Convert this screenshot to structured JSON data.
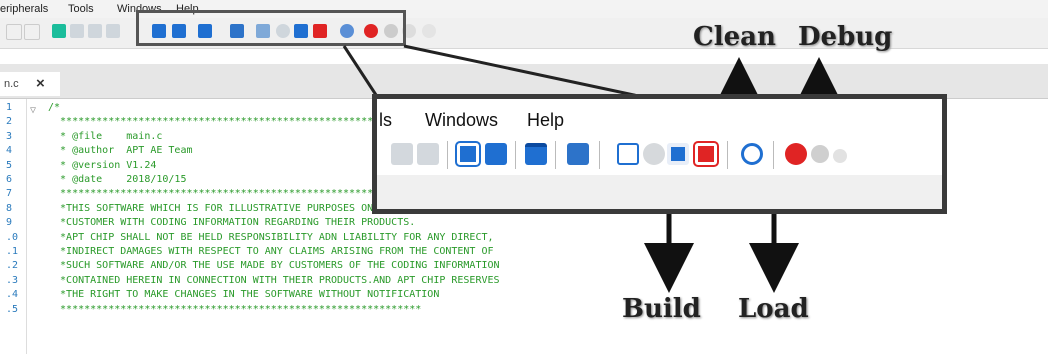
{
  "menubar": {
    "items": [
      "eripherals",
      "Tools",
      "Windows",
      "Help"
    ]
  },
  "tab": {
    "label": "n.c",
    "close": "×"
  },
  "editor": {
    "line_numbers": [
      "1",
      "2",
      "3",
      "4",
      "5",
      "6",
      "7",
      "8",
      "9",
      ".0",
      ".1",
      ".2",
      ".3",
      ".4",
      ".5"
    ],
    "lines": [
      "/*",
      "  ************************************************************",
      "  * @file    main.c",
      "  * @author  APT AE Team",
      "  * @version V1.24",
      "  * @date    2018/10/15",
      "  ************************************************************",
      "  *THIS SOFTWARE WHICH IS FOR ILLUSTRATIVE PURPOSES ONLY WHICH PROVIDES",
      "  *CUSTOMER WITH CODING INFORMATION REGARDING THEIR PRODUCTS.",
      "  *APT CHIP SHALL NOT BE HELD RESPONSIBILITY ADN LIABILITY FOR ANY DIRECT,",
      "  *INDIRECT DAMAGES WITH RESPECT TO ANY CLAIMS ARISING FROM THE CONTENT OF",
      "  *SUCH SOFTWARE AND/OR THE USE MADE BY CUSTOMERS OF THE CODING INFORMATION",
      "  *CONTAINED HEREIN IN CONNECTION WITH THEIR PRODUCTS.AND APT CHIP RESERVES",
      "  *THE RIGHT TO MAKE CHANGES IN THE SOFTWARE WITHOUT NOTIFICATION",
      "  ************************************************************"
    ]
  },
  "zoom": {
    "menu": [
      "ls",
      "Windows",
      "Help"
    ]
  },
  "callouts": {
    "clean": "Clean",
    "debug": "Debug",
    "build": "Build",
    "load": "Load"
  },
  "colors": {
    "code_green": "#2a9a2a",
    "line_number_blue": "#2b7bbd",
    "icon_blue": "#1f6fd1",
    "icon_red": "#e02424",
    "frame_dark": "#3a3a3a"
  }
}
